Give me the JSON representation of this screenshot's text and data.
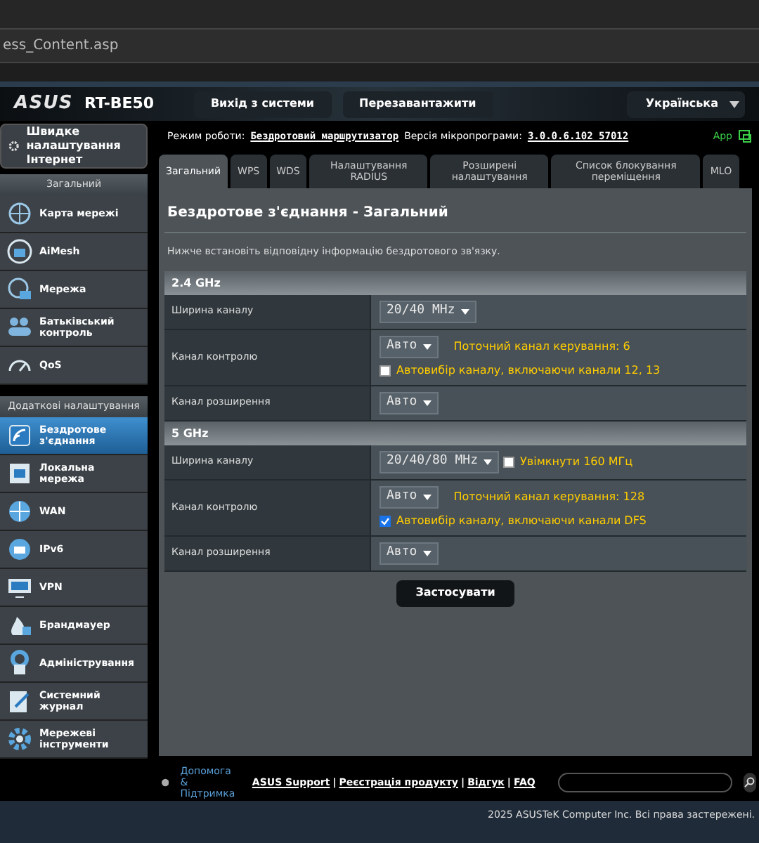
{
  "browser": {
    "url": "ess_Content.asp"
  },
  "header": {
    "logo": "ASUS",
    "model": "RT-BE50",
    "buttons": [
      "Вихід з системи",
      "Перезавантажити"
    ],
    "language": "Українська"
  },
  "status_line": {
    "mode_label": "Режим роботи:",
    "mode": "Бездротовий маршрутизатор",
    "firmware_label": "Версія мікропрограми:",
    "firmware": "3.0.0.6.102_57012",
    "app": "App"
  },
  "sidebar": {
    "quick_setup": "Швидке налаштування Інтернет",
    "sections": [
      {
        "title": "Загальний",
        "items": [
          {
            "label": "Карта мережі",
            "selected": false
          },
          {
            "label": "AiMesh",
            "selected": false
          },
          {
            "label": "Мережа",
            "selected": false
          },
          {
            "label": "Батьківський контроль",
            "selected": false
          },
          {
            "label": "QoS",
            "selected": false
          }
        ]
      },
      {
        "title": "Додаткові налаштування",
        "items": [
          {
            "label": "Бездротове з'єднання",
            "selected": true
          },
          {
            "label": "Локальна мережа",
            "selected": false
          },
          {
            "label": "WAN",
            "selected": false
          },
          {
            "label": "IPv6",
            "selected": false
          },
          {
            "label": "VPN",
            "selected": false
          },
          {
            "label": "Брандмауер",
            "selected": false
          },
          {
            "label": "Адміністрування",
            "selected": false
          },
          {
            "label": "Системний журнал",
            "selected": false
          },
          {
            "label": "Мережеві інструменти",
            "selected": false
          }
        ]
      }
    ]
  },
  "tabs": [
    {
      "label": "Загальний",
      "selected": true
    },
    {
      "label": "WPS",
      "selected": false
    },
    {
      "label": "WDS",
      "selected": false
    },
    {
      "label": "Налаштування RADIUS",
      "selected": false
    },
    {
      "label": "Розширені налаштування",
      "selected": false
    },
    {
      "label": "Список блокування переміщення",
      "selected": false
    },
    {
      "label": "MLO",
      "selected": false
    }
  ],
  "panel": {
    "title": "Бездротове з'єднання - Загальний",
    "description": "Нижче встановіть відповідну інформацію бездротового зв'язку.",
    "sections": [
      {
        "title": "2.4 GHz",
        "rows": [
          {
            "label": "Ширина каналу",
            "lines": [
              [
                {
                  "kind": "select",
                  "value": "20/40 MHz"
                }
              ]
            ]
          },
          {
            "label": "Канал контролю",
            "lines": [
              [
                {
                  "kind": "select",
                  "value": "Авто"
                },
                {
                  "kind": "note",
                  "text": "Поточний канал керування: 6"
                }
              ],
              [
                {
                  "kind": "checkbox",
                  "label": "Автовибір каналу, включаючи канали 12, 13",
                  "checked": false
                }
              ]
            ]
          },
          {
            "label": "Канал розширення",
            "lines": [
              [
                {
                  "kind": "select",
                  "value": "Авто"
                }
              ]
            ]
          }
        ]
      },
      {
        "title": "5 GHz",
        "rows": [
          {
            "label": "Ширина каналу",
            "lines": [
              [
                {
                  "kind": "select",
                  "value": "20/40/80 MHz"
                },
                {
                  "kind": "checkbox",
                  "label": "Увімкнути 160 МГц",
                  "checked": false
                }
              ]
            ]
          },
          {
            "label": "Канал контролю",
            "lines": [
              [
                {
                  "kind": "select",
                  "value": "Авто"
                },
                {
                  "kind": "note",
                  "text": "Поточний канал керування: 128"
                }
              ],
              [
                {
                  "kind": "checkbox",
                  "label": "Автовибір каналу, включаючи канали DFS",
                  "checked": true
                }
              ]
            ]
          },
          {
            "label": "Канал розширення",
            "lines": [
              [
                {
                  "kind": "select",
                  "value": "Авто"
                }
              ]
            ]
          }
        ]
      }
    ],
    "apply": "Застосувати"
  },
  "footer": {
    "help": "Допомога & Підтримка",
    "links": [
      "ASUS Support",
      "Реєстрація продукту",
      "Відгук",
      "FAQ"
    ],
    "separator": "|"
  },
  "copyright": "2025 ASUSTeK Computer Inc. Всі права застережені."
}
